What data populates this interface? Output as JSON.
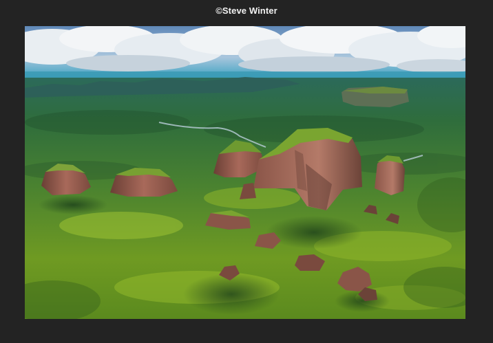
{
  "viewer": {
    "credit": "©Steve Winter"
  },
  "photo": {
    "subject": "aerial-landscape-tepuis",
    "colors": {
      "sky_top": "#5f88b8",
      "sky_low": "#a9c6dd",
      "cloud": "#eef2f5",
      "cloud_shadow": "#b9c4cf",
      "horizon": "#2f8fa8",
      "forest_far": "#2c6a4e",
      "forest_mid": "#3f7a2e",
      "forest_near": "#6f9a22",
      "canopy_bright": "#8fb62a",
      "rock": "#9b5a4c",
      "rock_dark": "#5e3a32",
      "river": "#b9cdd8"
    }
  }
}
